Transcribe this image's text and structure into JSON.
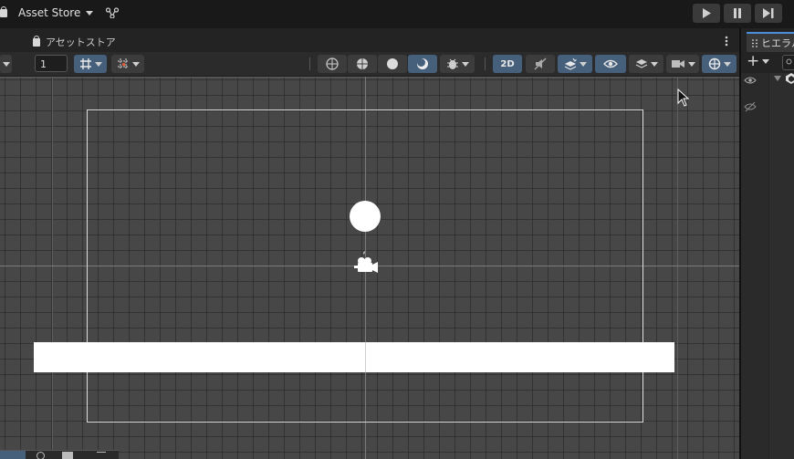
{
  "topbar": {
    "store_label": "Asset Store",
    "play_buttons": [
      "play-icon",
      "pause-icon",
      "step-icon"
    ]
  },
  "scene_tab": {
    "label": "アセットストア"
  },
  "toolbar": {
    "grid_increment_value": "1",
    "mode_2d_label": "2D",
    "active_tools": [
      "2d-toggle",
      "effects-toggle",
      "visibility-toggle",
      "gizmos-toggle",
      "grid-snap-toggle",
      "lit-shading"
    ]
  },
  "hierarchy": {
    "tab_label": "ヒエラル",
    "add_label": "+"
  },
  "colors": {
    "accent_blue": "#46607c",
    "tab_highlight": "#4a8dd8",
    "scene_background": "#474747",
    "sprite_white": "#ffffff"
  }
}
